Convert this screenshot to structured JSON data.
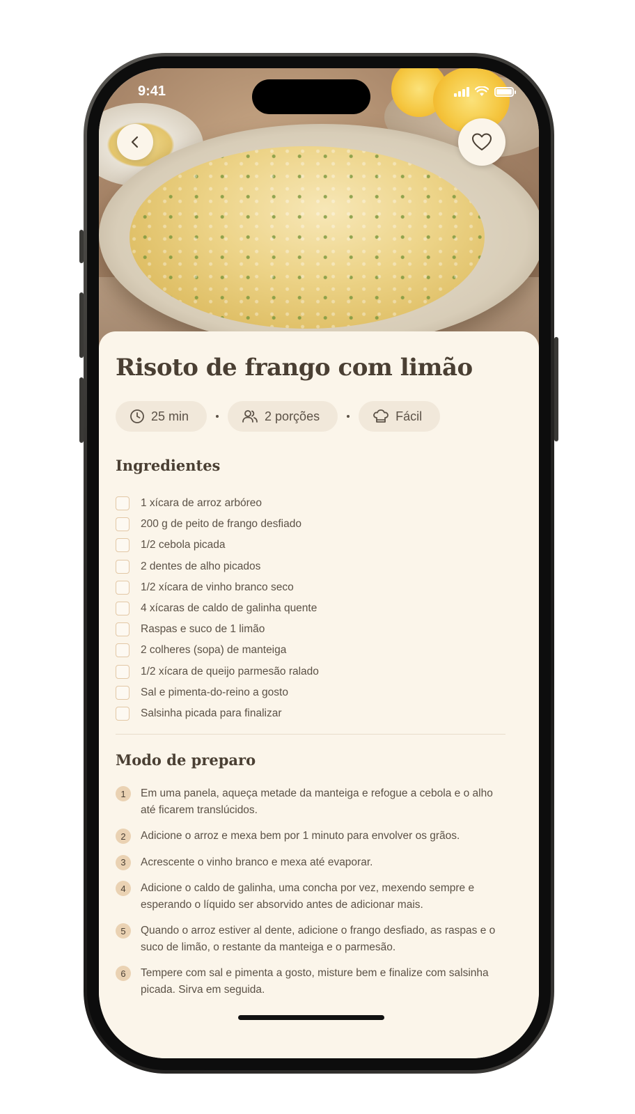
{
  "status_bar": {
    "time": "9:41"
  },
  "hero": {
    "back_icon": "chevron-left-icon",
    "favorite_icon": "heart-icon"
  },
  "recipe": {
    "title": "Risoto de frango com limão",
    "meta": {
      "time": "25 min",
      "servings": "2 porções",
      "difficulty": "Fácil",
      "separator": "•"
    }
  },
  "ingredients": {
    "heading": "Ingredientes",
    "items": [
      "1 xícara de arroz arbóreo",
      "200 g de peito de frango desfiado",
      "1/2 cebola picada",
      "2 dentes de alho picados",
      "1/2 xícara de vinho branco seco",
      "4 xícaras de caldo de galinha quente",
      "Raspas e suco de 1 limão",
      "2 colheres (sopa) de manteiga",
      "1/2 xícara de queijo parmesão ralado",
      "Sal e pimenta-do-reino a gosto",
      "Salsinha picada para finalizar"
    ]
  },
  "preparation": {
    "heading": "Modo de preparo",
    "steps": [
      {
        "number": "1",
        "text": "Em uma panela, aqueça metade da manteiga e refogue a cebola e o alho até ficarem translúcidos."
      },
      {
        "number": "2",
        "text": "Adicione o arroz e mexa bem por 1 minuto para envolver os grãos."
      },
      {
        "number": "3",
        "text": "Acrescente o vinho branco e mexa até evaporar."
      },
      {
        "number": "4",
        "text": "Adicione o caldo de galinha, uma concha por vez, mexendo sempre e esperando o líquido ser absorvido antes de adicionar mais."
      },
      {
        "number": "5",
        "text": "Quando o arroz estiver al dente, adicione o frango desfiado, as raspas e o suco de limão, o restante da manteiga e o parmesão."
      },
      {
        "number": "6",
        "text": "Tempere com sal e pimenta a gosto, misture bem e finalize com salsinha picada. Sirva em seguida."
      }
    ]
  },
  "colors": {
    "background": "#fbf5ea",
    "chip": "#f1e8da",
    "text_dark": "#4a3f33",
    "text_body": "#5b5146",
    "accent": "#ead2b3"
  }
}
